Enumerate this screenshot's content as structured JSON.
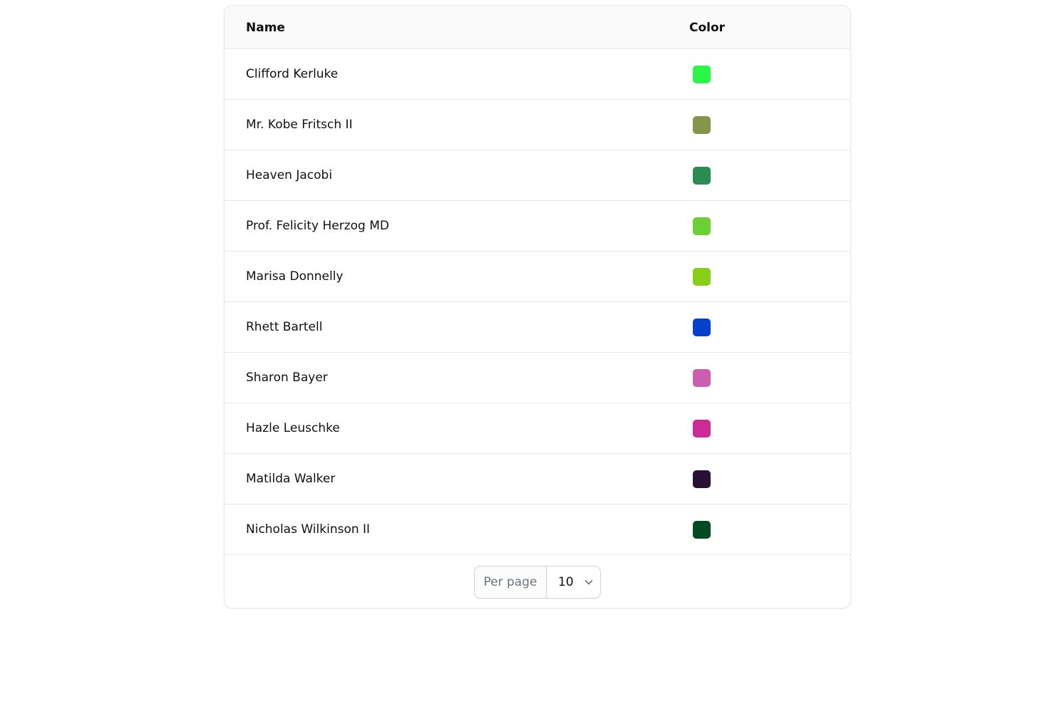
{
  "table": {
    "headers": {
      "name": "Name",
      "color": "Color"
    },
    "rows": [
      {
        "name": "Clifford Kerluke",
        "color": "#2cf64a"
      },
      {
        "name": "Mr. Kobe Fritsch II",
        "color": "#84954c"
      },
      {
        "name": "Heaven Jacobi",
        "color": "#2a8c52"
      },
      {
        "name": "Prof. Felicity Herzog MD",
        "color": "#6ccf36"
      },
      {
        "name": "Marisa Donnelly",
        "color": "#88cf1a"
      },
      {
        "name": "Rhett Bartell",
        "color": "#0640cc"
      },
      {
        "name": "Sharon Bayer",
        "color": "#cc5eb2"
      },
      {
        "name": "Hazle Leuschke",
        "color": "#cc2a96"
      },
      {
        "name": "Matilda Walker",
        "color": "#2a1034"
      },
      {
        "name": "Nicholas Wilkinson II",
        "color": "#014a22"
      }
    ]
  },
  "pagination": {
    "per_page_label": "Per page",
    "per_page_value": "10",
    "chevron_icon": "chevron-down-icon"
  }
}
